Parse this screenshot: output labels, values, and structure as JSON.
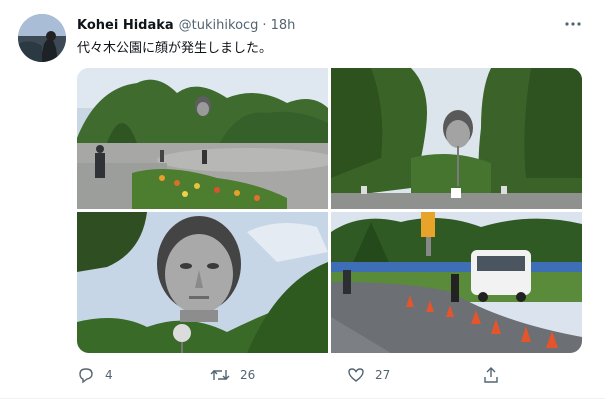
{
  "tweet": {
    "display_name": "Kohei Hidaka",
    "handle": "@tukihikocg",
    "separator": "·",
    "time": "18h",
    "text": "代々木公園に顔が発生しました。"
  },
  "media": {
    "photo_count": 4
  },
  "actions": {
    "reply_count": "4",
    "retweet_count": "26",
    "like_count": "27"
  },
  "icons": [
    "more-icon",
    "reply-icon",
    "retweet-icon",
    "like-icon",
    "share-icon"
  ],
  "colors": {
    "text_primary": "#0f1419",
    "text_secondary": "#536471",
    "divider": "#eff3f4"
  }
}
